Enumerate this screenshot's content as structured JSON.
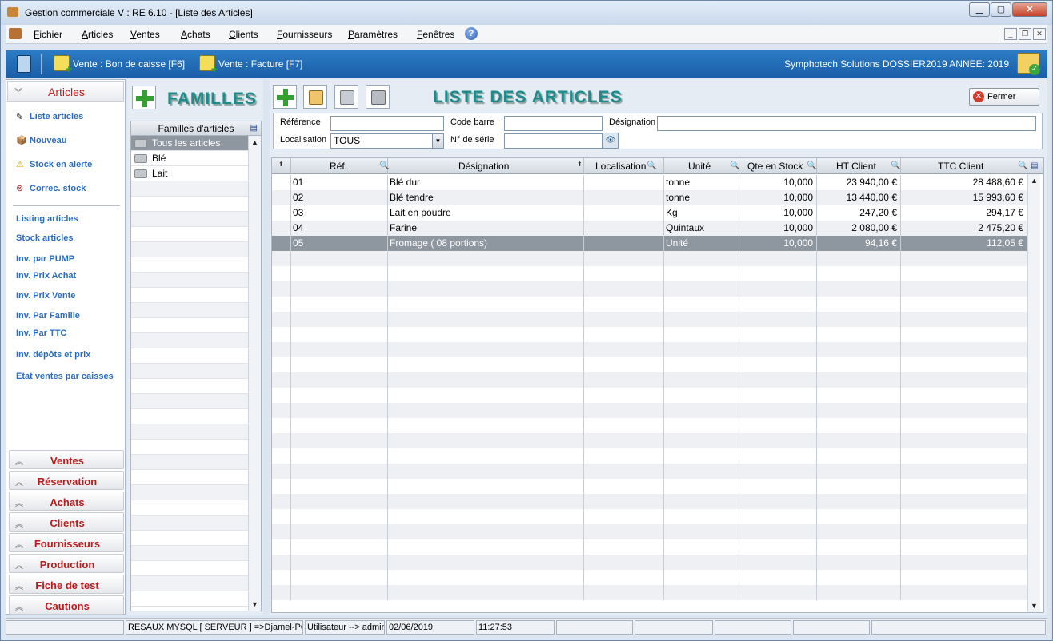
{
  "window": {
    "title": "Gestion commerciale  V : RE 6.10 - [Liste des Articles]"
  },
  "menu": [
    "Fichier",
    "Articles",
    "Ventes",
    "Achats",
    "Clients",
    "Fournisseurs",
    "Paramètres",
    "Fenêtres"
  ],
  "toolbar": {
    "vente_bon": "Vente : Bon de caisse [F6]",
    "vente_facture": "Vente : Facture [F7]",
    "company": "Symphotech Solutions  DOSSIER2019 ANNEE:  2019"
  },
  "sidebar": {
    "section": "Articles",
    "links1": [
      "Liste articles",
      "Nouveau",
      "Stock en alerte",
      "Correc. stock"
    ],
    "links2": [
      "Listing articles",
      "Stock articles",
      "Inv. par PUMP",
      "Inv.  Prix Achat",
      "Inv.  Prix Vente",
      "Inv.  Par Famille",
      "Inv.  Par TTC",
      "Inv. dépôts et prix",
      "Etat ventes par caisses"
    ],
    "accordions": [
      "Ventes",
      "Réservation",
      "Achats",
      "Clients",
      "Fournisseurs",
      "Production",
      "Fiche de test",
      "Cautions"
    ]
  },
  "familles": {
    "title": "FAMILLES",
    "list_header": "Familles d'articles",
    "items": [
      "Tous les articles",
      "Blé",
      "Lait"
    ]
  },
  "articles": {
    "title": "LISTE DES ARTICLES",
    "fermer": "Fermer",
    "filters": {
      "reference_label": "Référence",
      "codebarre_label": "Code barre",
      "designation_label": "Désignation",
      "localisation_label": "Localisation",
      "localisation_value": "TOUS",
      "serie_label": "N° de série",
      "reference_value": "",
      "codebarre_value": "",
      "designation_value": "",
      "serie_value": ""
    },
    "columns": [
      "Réf.",
      "Désignation",
      "Localisation",
      "Unité",
      "Qte en Stock",
      "HT Client",
      "TTC Client"
    ],
    "rows": [
      {
        "ref": "01",
        "designation": "Blé dur",
        "localisation": "",
        "unite": "tonne",
        "qte": "10,000",
        "ht": "23 940,00 €",
        "ttc": "28 488,60 €"
      },
      {
        "ref": "02",
        "designation": "Blé tendre",
        "localisation": "",
        "unite": "tonne",
        "qte": "10,000",
        "ht": "13 440,00 €",
        "ttc": "15 993,60 €"
      },
      {
        "ref": "03",
        "designation": "Lait en poudre",
        "localisation": "",
        "unite": " Kg",
        "qte": "10,000",
        "ht": "247,20 €",
        "ttc": "294,17 €"
      },
      {
        "ref": "04",
        "designation": "Farine",
        "localisation": "",
        "unite": "Quintaux",
        "qte": "10,000",
        "ht": "2 080,00 €",
        "ttc": "2 475,20 €"
      },
      {
        "ref": "05",
        "designation": "Fromage ( 08 portions)",
        "localisation": "",
        "unite": "Unité",
        "qte": "10,000",
        "ht": "94,16 €",
        "ttc": "112,05 €"
      }
    ]
  },
  "status": {
    "server": "RESAUX MYSQL [ SERVEUR ] =>Djamel-PC",
    "user": "Utilisateur -->  admin",
    "date": "02/06/2019",
    "time": "11:27:53"
  }
}
